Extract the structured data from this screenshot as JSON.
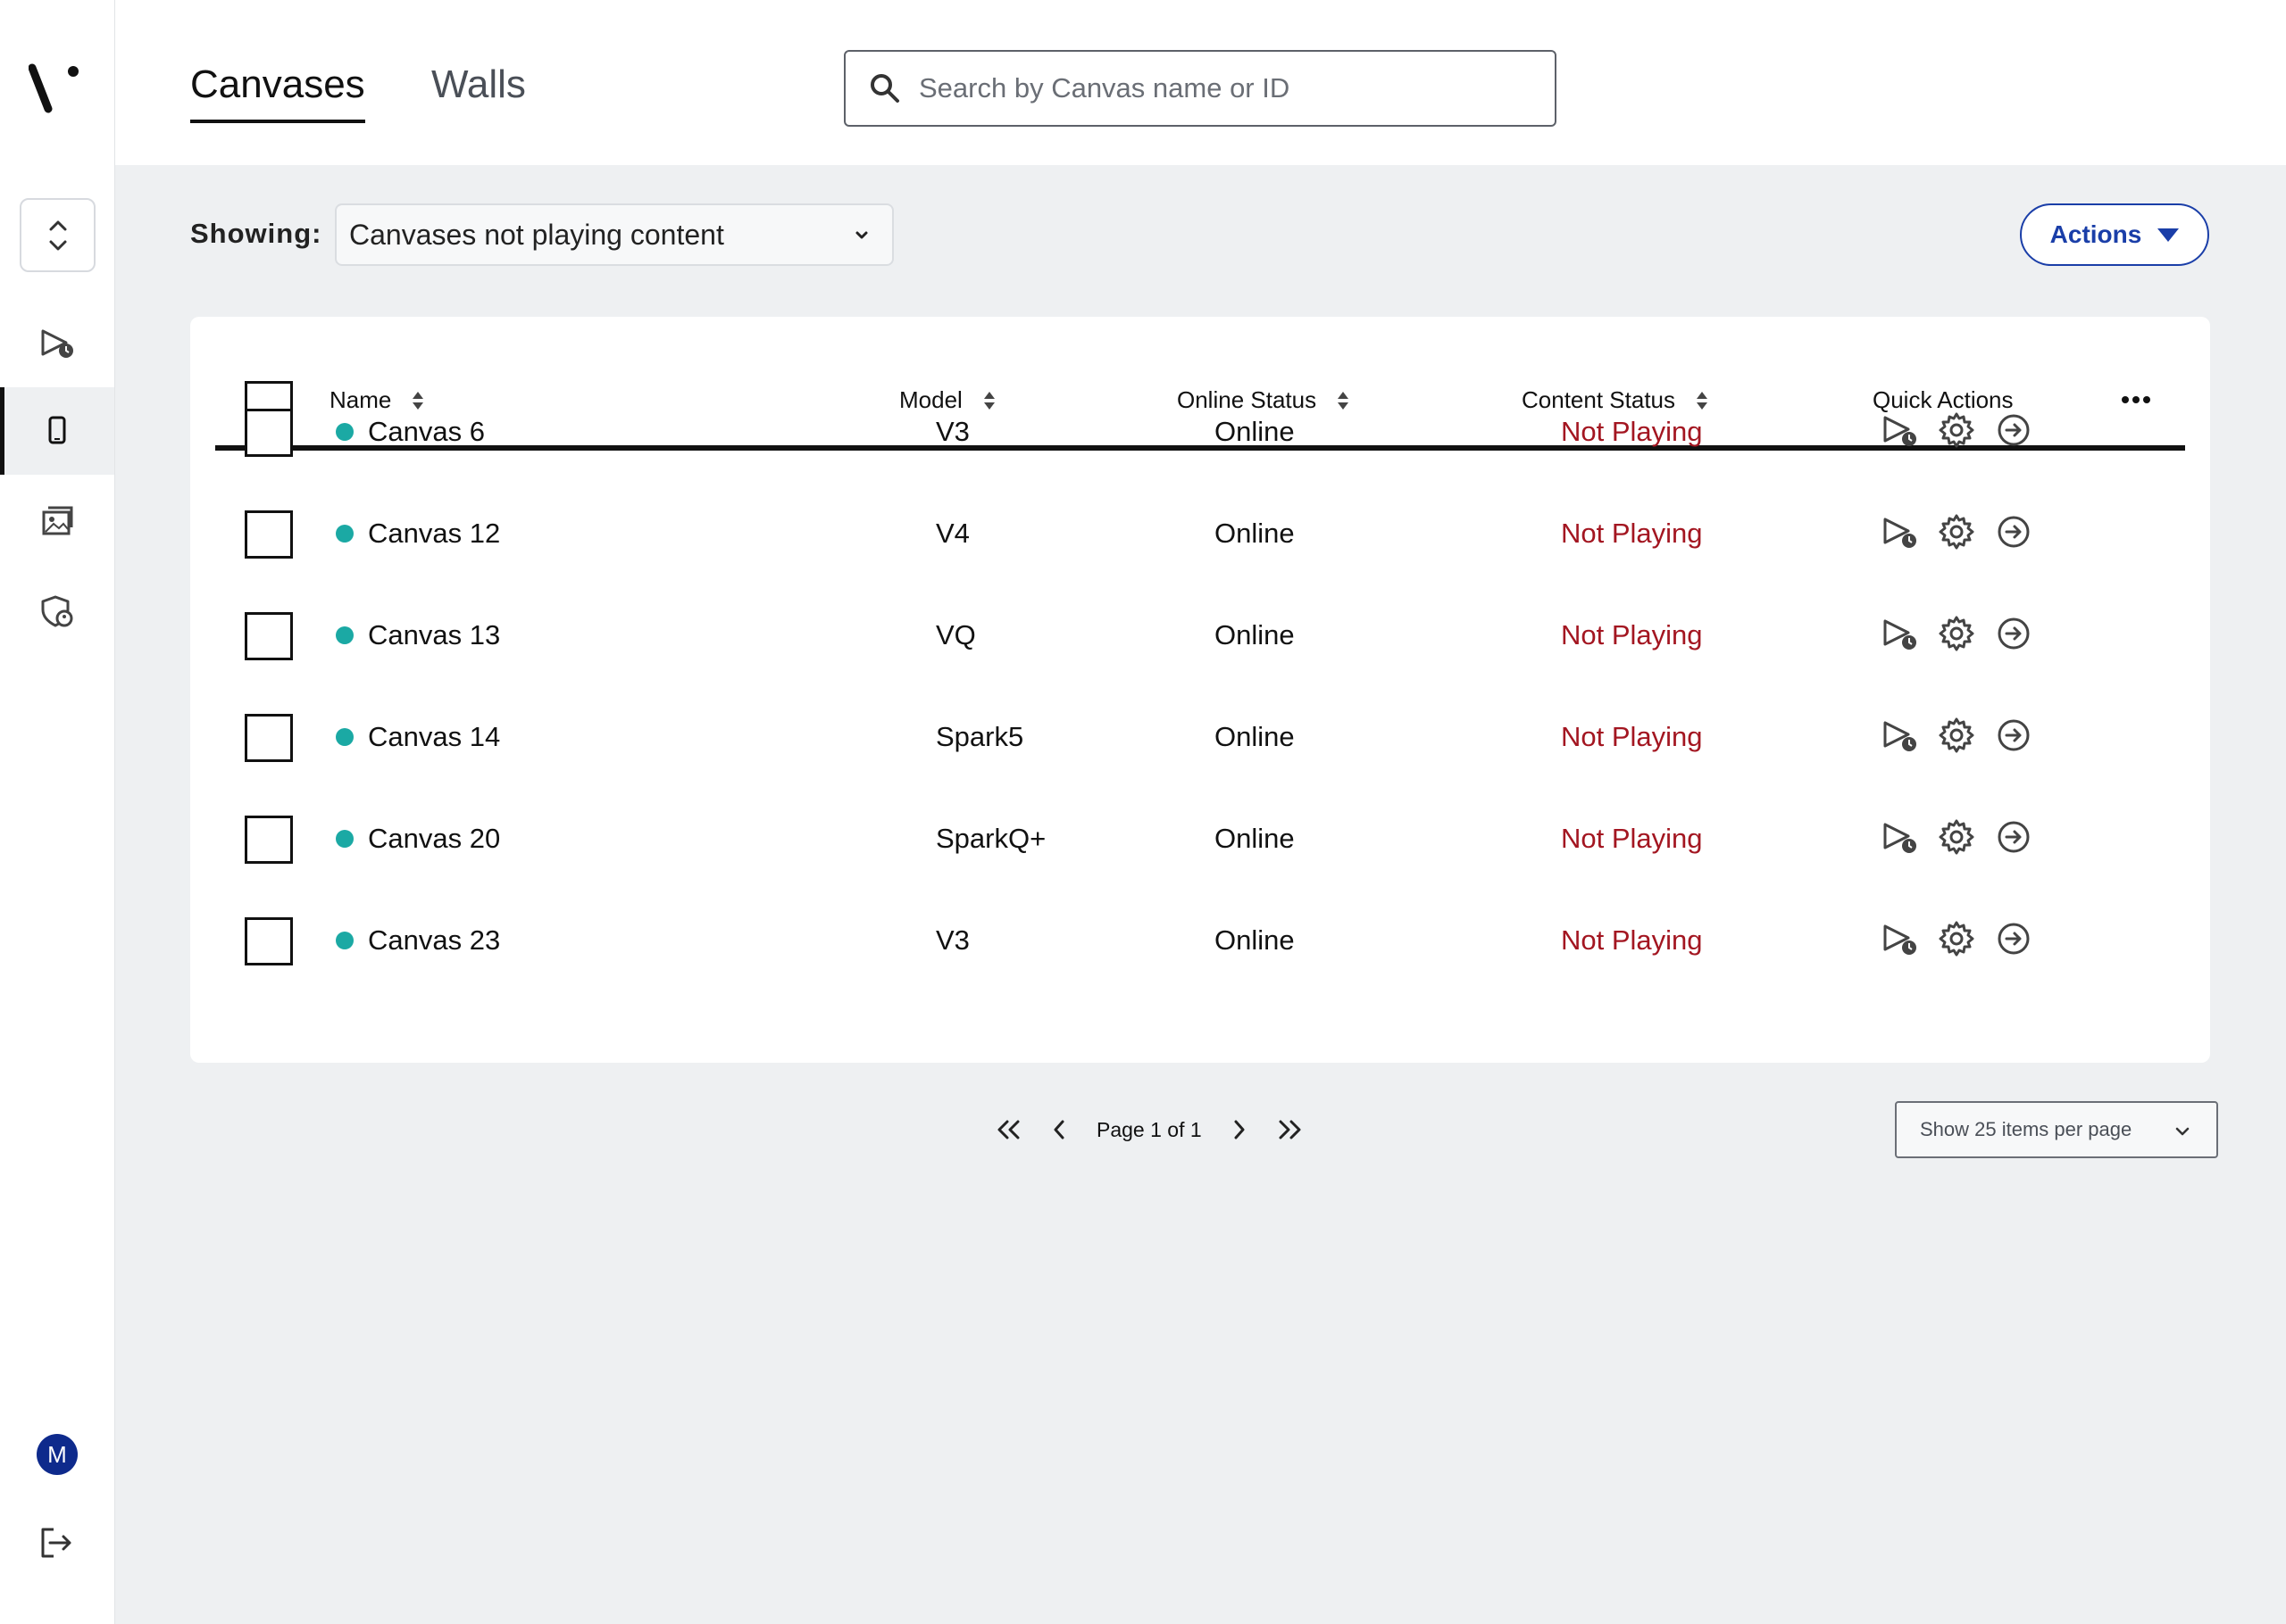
{
  "header": {
    "tabs": [
      {
        "label": "Canvases",
        "active": true
      },
      {
        "label": "Walls",
        "active": false
      }
    ],
    "search": {
      "placeholder": "Search by Canvas name or ID",
      "value": ""
    }
  },
  "sidebar": {
    "items": [
      {
        "name": "schedule-icon"
      },
      {
        "name": "device-icon",
        "active": true
      },
      {
        "name": "media-library-icon"
      },
      {
        "name": "security-icon"
      }
    ],
    "avatar_initial": "M"
  },
  "filter": {
    "label": "Showing:",
    "selected": "Canvases not playing content"
  },
  "actions_label": "Actions",
  "table": {
    "columns": [
      "Name",
      "Model",
      "Online Status",
      "Content Status",
      "Quick Actions"
    ],
    "rows": [
      {
        "name": "Canvas 6",
        "model": "V3",
        "online": "Online",
        "content": "Not Playing"
      },
      {
        "name": "Canvas 12",
        "model": "V4",
        "online": "Online",
        "content": "Not Playing"
      },
      {
        "name": "Canvas 13",
        "model": "VQ",
        "online": "Online",
        "content": "Not Playing"
      },
      {
        "name": "Canvas 14",
        "model": "Spark5",
        "online": "Online",
        "content": "Not Playing"
      },
      {
        "name": "Canvas 20",
        "model": "SparkQ+",
        "online": "Online",
        "content": "Not Playing"
      },
      {
        "name": "Canvas 23",
        "model": "V3",
        "online": "Online",
        "content": "Not Playing"
      }
    ]
  },
  "pagination": {
    "page_text": "Page 1 of 1",
    "per_page": "Show 25 items per page"
  },
  "colors": {
    "accent": "#1a3ea8",
    "status_dot": "#1ba9a4",
    "not_playing": "#a31621"
  }
}
